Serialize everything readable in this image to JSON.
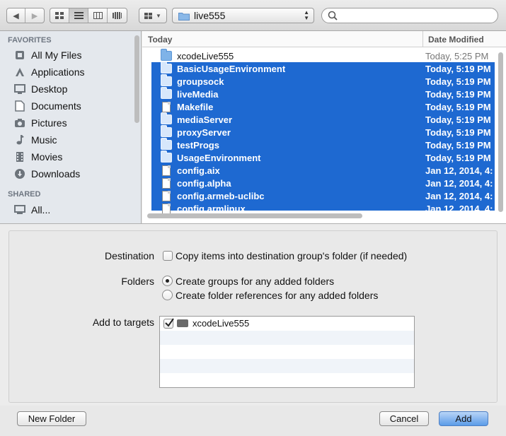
{
  "toolbar": {
    "path_label": "live555",
    "search_placeholder": ""
  },
  "sidebar": {
    "favorites_heading": "FAVORITES",
    "favorites": [
      {
        "label": "All My Files",
        "icon": "all-files-icon"
      },
      {
        "label": "Applications",
        "icon": "applications-icon"
      },
      {
        "label": "Desktop",
        "icon": "desktop-icon"
      },
      {
        "label": "Documents",
        "icon": "documents-icon"
      },
      {
        "label": "Pictures",
        "icon": "pictures-icon"
      },
      {
        "label": "Music",
        "icon": "music-icon"
      },
      {
        "label": "Movies",
        "icon": "movies-icon"
      },
      {
        "label": "Downloads",
        "icon": "downloads-icon"
      }
    ],
    "shared_heading": "SHARED",
    "shared": [
      {
        "label": "All...",
        "icon": "network-icon"
      }
    ]
  },
  "file_list": {
    "col_name": "Today",
    "col_date": "Date Modified",
    "rows": [
      {
        "name": "xcodeLive555",
        "date": "Today, 5:25 PM",
        "kind": "folder",
        "selected": false
      },
      {
        "name": "BasicUsageEnvironment",
        "date": "Today, 5:19 PM",
        "kind": "folder",
        "selected": true
      },
      {
        "name": "groupsock",
        "date": "Today, 5:19 PM",
        "kind": "folder",
        "selected": true
      },
      {
        "name": "liveMedia",
        "date": "Today, 5:19 PM",
        "kind": "folder",
        "selected": true
      },
      {
        "name": "Makefile",
        "date": "Today, 5:19 PM",
        "kind": "file",
        "selected": true
      },
      {
        "name": "mediaServer",
        "date": "Today, 5:19 PM",
        "kind": "folder",
        "selected": true
      },
      {
        "name": "proxyServer",
        "date": "Today, 5:19 PM",
        "kind": "folder",
        "selected": true
      },
      {
        "name": "testProgs",
        "date": "Today, 5:19 PM",
        "kind": "folder",
        "selected": true
      },
      {
        "name": "UsageEnvironment",
        "date": "Today, 5:19 PM",
        "kind": "folder",
        "selected": true
      },
      {
        "name": "config.aix",
        "date": "Jan 12, 2014, 4:",
        "kind": "file",
        "selected": true
      },
      {
        "name": "config.alpha",
        "date": "Jan 12, 2014, 4:",
        "kind": "file",
        "selected": true
      },
      {
        "name": "config.armeb-uclibc",
        "date": "Jan 12, 2014, 4:",
        "kind": "file",
        "selected": true
      },
      {
        "name": "config.armlinux",
        "date": "Jan 12, 2014, 4:",
        "kind": "file",
        "selected": true
      }
    ]
  },
  "options": {
    "destination_label": "Destination",
    "destination_checkbox": "Copy items into destination group's folder (if needed)",
    "folders_label": "Folders",
    "folders_option1": "Create groups for any added folders",
    "folders_option2": "Create folder references for any added folders",
    "targets_label": "Add to targets",
    "targets": [
      {
        "name": "xcodeLive555",
        "checked": true
      }
    ]
  },
  "buttons": {
    "new_folder": "New Folder",
    "cancel": "Cancel",
    "add": "Add"
  }
}
